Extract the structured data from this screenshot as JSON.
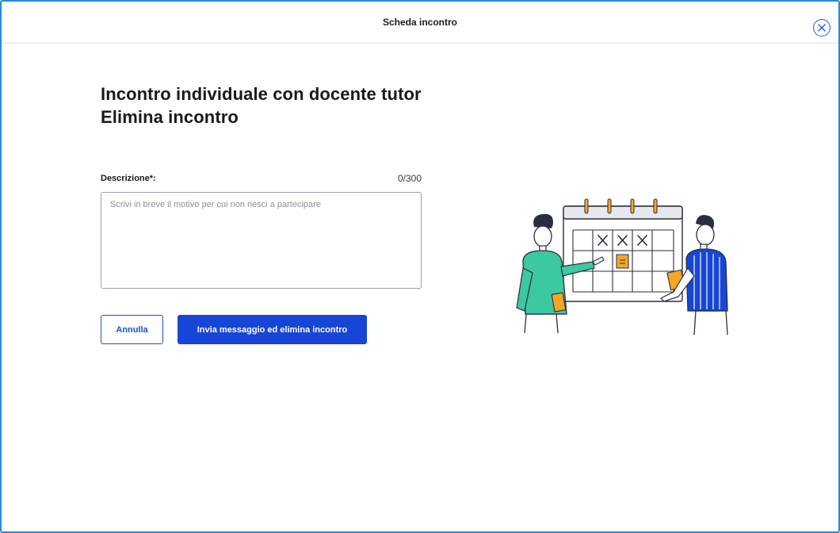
{
  "header": {
    "title": "Scheda incontro",
    "close_icon": "close-circle-icon"
  },
  "main": {
    "title_line1": "Incontro individuale con docente tutor",
    "title_line2": "Elimina incontro"
  },
  "form": {
    "description_label": "Descrizione*:",
    "counter": "0/300",
    "description_value": "",
    "description_placeholder": "Scrivi in breve il motivo per cui non riesci a partecipare"
  },
  "actions": {
    "cancel_label": "Annulla",
    "submit_label": "Invia messaggio ed elimina incontro"
  },
  "colors": {
    "accent": "#1746d6",
    "modal_border": "#2b8ad8",
    "illustration_green": "#3cc8a0",
    "illustration_blue": "#1746d6",
    "illustration_orange": "#f5a623"
  }
}
